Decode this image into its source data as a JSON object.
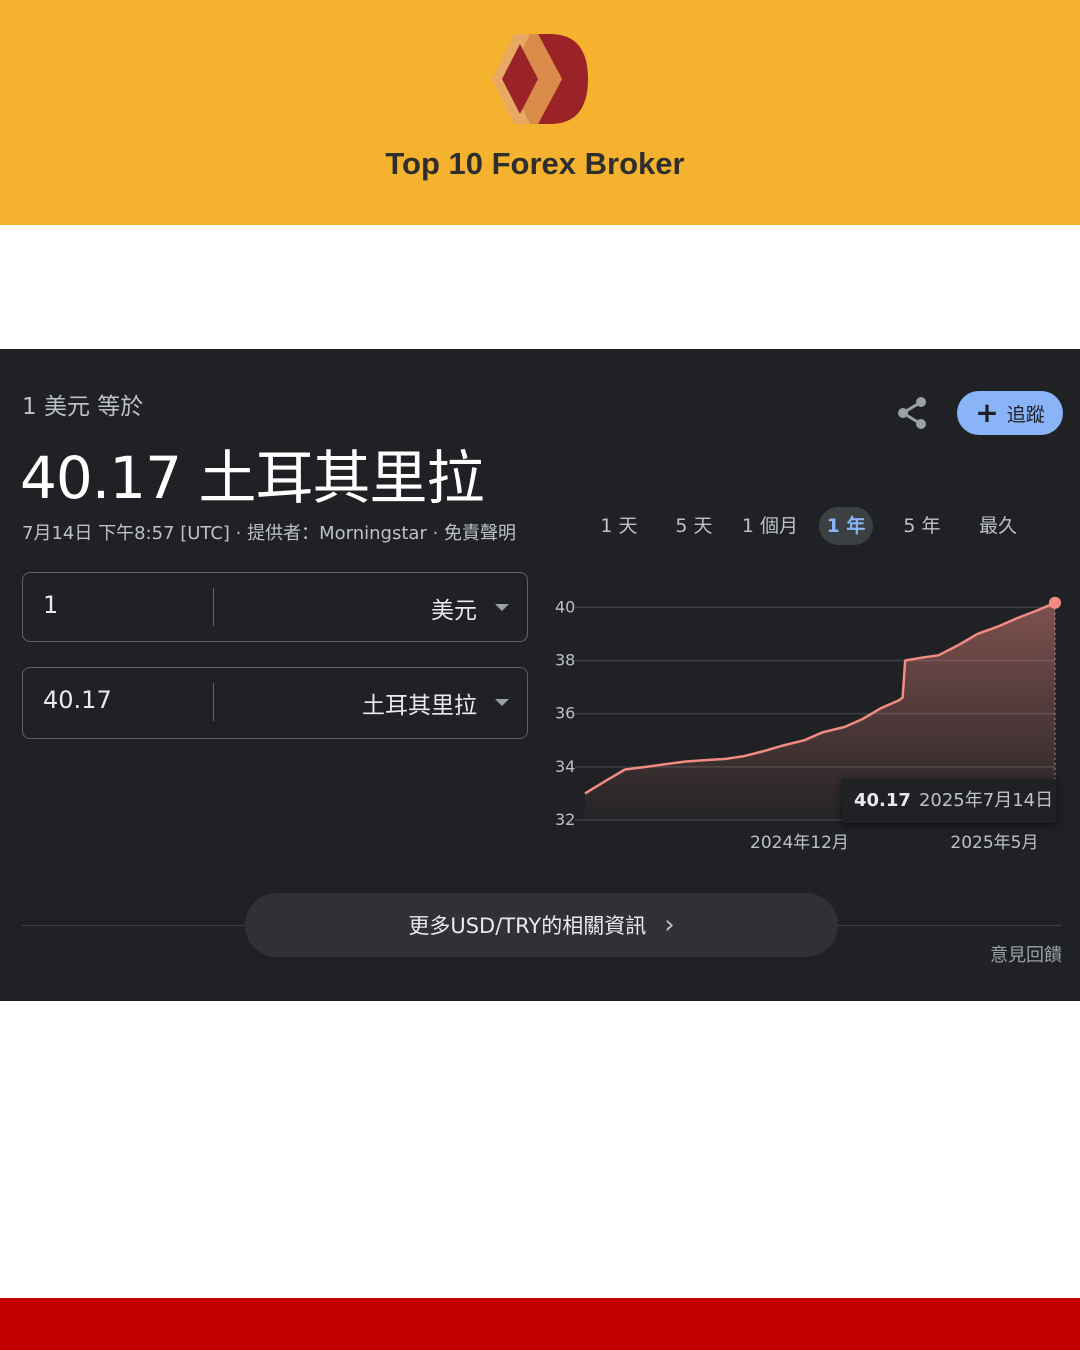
{
  "brand": {
    "title": "Top 10 Forex Broker"
  },
  "converter": {
    "equal_label": "1 美元 等於",
    "result": "40.17 土耳其里拉",
    "meta": "7月14日 下午8:57 [UTC] · 提供者：Morningstar · 免責聲明",
    "follow_label": "追蹤",
    "from": {
      "amount": "1",
      "currency": "美元"
    },
    "to": {
      "amount": "40.17",
      "currency": "土耳其里拉"
    }
  },
  "range_tabs": [
    {
      "label": "1 天",
      "active": false
    },
    {
      "label": "5 天",
      "active": false
    },
    {
      "label": "1 個月",
      "active": false
    },
    {
      "label": "1 年",
      "active": true
    },
    {
      "label": "5 年",
      "active": false
    },
    {
      "label": "最久",
      "active": false
    }
  ],
  "chart_data": {
    "type": "area",
    "y_ticks": [
      40,
      38,
      36,
      34,
      32
    ],
    "ylim": [
      32,
      40.2
    ],
    "x_tick_labels": [
      "2024年12月",
      "2025年5月"
    ],
    "x": [
      "2024-07-15",
      "2024-08-01",
      "2024-08-15",
      "2024-09-01",
      "2024-09-15",
      "2024-10-01",
      "2024-10-15",
      "2024-11-01",
      "2024-11-15",
      "2024-12-01",
      "2024-12-15",
      "2025-01-01",
      "2025-01-15",
      "2025-02-01",
      "2025-02-15",
      "2025-03-01",
      "2025-03-15",
      "2025-03-18",
      "2025-03-20",
      "2025-04-01",
      "2025-04-15",
      "2025-05-01",
      "2025-05-15",
      "2025-06-01",
      "2025-06-15",
      "2025-07-01",
      "2025-07-14"
    ],
    "values": [
      33.0,
      33.5,
      33.9,
      34.0,
      34.1,
      34.2,
      34.25,
      34.3,
      34.4,
      34.6,
      34.8,
      35.0,
      35.3,
      35.5,
      35.8,
      36.2,
      36.5,
      36.6,
      38.0,
      38.1,
      38.2,
      38.6,
      39.0,
      39.3,
      39.6,
      39.9,
      40.17
    ],
    "tooltip": {
      "value": "40.17",
      "date": "2025年7月14日"
    },
    "colors": {
      "line": "#f28b82",
      "fill": "#f28b82",
      "grid": "#3c4043",
      "axis_text": "#bdc1c6"
    }
  },
  "more_button_label": "更多USD/TRY的相關資訊",
  "feedback_label": "意見回饋",
  "icons": {
    "share": "share-icon",
    "plus": "plus-icon",
    "chevron": "chevron-right-icon",
    "caret": "caret-down-icon"
  }
}
